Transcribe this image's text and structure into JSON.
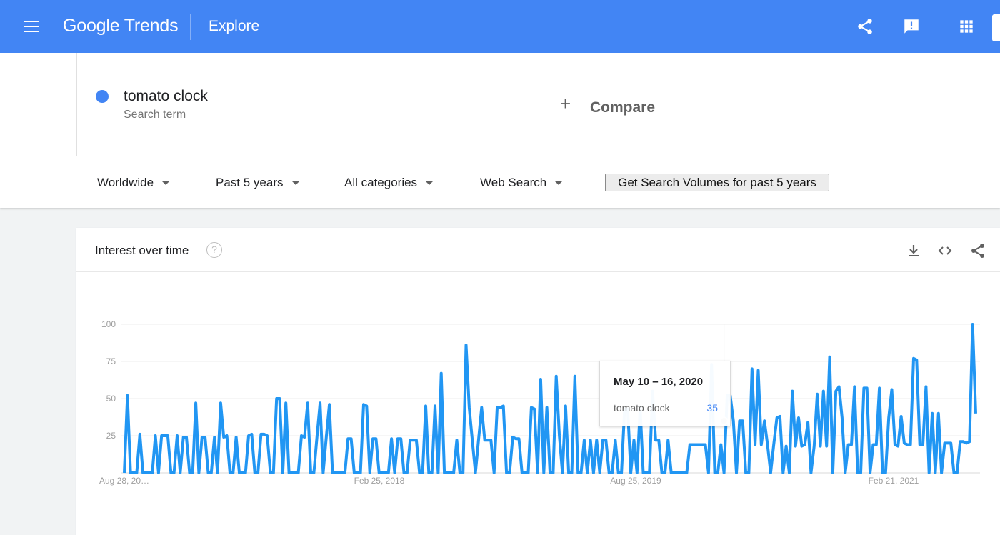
{
  "header": {
    "logo": "Google Trends",
    "section": "Explore",
    "icons": [
      "menu-icon",
      "share-icon",
      "feedback-icon",
      "apps-icon"
    ]
  },
  "search_term": {
    "name": "tomato clock",
    "subtitle": "Search term",
    "color": "#4285f4"
  },
  "compare": {
    "plus": "+",
    "label": "Compare"
  },
  "filters": {
    "region": "Worldwide",
    "period": "Past 5 years",
    "category": "All categories",
    "search_type": "Web Search",
    "volume_button": "Get Search Volumes for past 5 years"
  },
  "card": {
    "title": "Interest over time",
    "help": "?"
  },
  "tooltip": {
    "date": "May 10 – 16, 2020",
    "term": "tomato clock",
    "value": "35"
  },
  "chart_data": {
    "type": "line",
    "x_start": "Aug 28, 2016",
    "x_interval_days": 7,
    "x_tick_labels": [
      "Aug 28, 20…",
      "Feb 25, 2018",
      "Aug 25, 2019",
      "Feb 21, 2021"
    ],
    "y_ticks": [
      25,
      50,
      75,
      100
    ],
    "ylim": [
      0,
      100
    ],
    "grid": true,
    "line_color": "#2196f3",
    "series": [
      {
        "name": "tomato clock",
        "values": [
          0,
          52,
          0,
          0,
          0,
          26,
          0,
          0,
          0,
          0,
          25,
          0,
          25,
          25,
          25,
          0,
          0,
          25,
          0,
          24,
          24,
          0,
          0,
          47,
          0,
          24,
          24,
          0,
          0,
          24,
          0,
          47,
          24,
          25,
          0,
          0,
          24,
          0,
          0,
          0,
          25,
          26,
          0,
          0,
          26,
          26,
          25,
          0,
          0,
          50,
          50,
          0,
          47,
          0,
          0,
          0,
          0,
          25,
          24,
          47,
          0,
          0,
          24,
          47,
          0,
          24,
          46,
          0,
          0,
          0,
          0,
          0,
          23,
          23,
          0,
          0,
          0,
          46,
          45,
          0,
          23,
          23,
          0,
          0,
          0,
          0,
          23,
          0,
          23,
          23,
          0,
          0,
          22,
          22,
          22,
          0,
          0,
          45,
          0,
          0,
          45,
          0,
          67,
          0,
          0,
          0,
          0,
          22,
          0,
          0,
          86,
          44,
          22,
          0,
          22,
          44,
          22,
          22,
          22,
          0,
          44,
          44,
          45,
          0,
          0,
          24,
          23,
          23,
          0,
          0,
          0,
          44,
          43,
          0,
          63,
          0,
          44,
          0,
          0,
          65,
          25,
          0,
          45,
          0,
          0,
          65,
          0,
          0,
          22,
          0,
          22,
          0,
          22,
          0,
          22,
          22,
          0,
          0,
          22,
          0,
          0,
          43,
          43,
          0,
          22,
          0,
          44,
          0,
          0,
          0,
          55,
          22,
          22,
          0,
          0,
          22,
          0,
          0,
          0,
          0,
          0,
          0,
          19,
          19,
          19,
          19,
          19,
          19,
          0,
          73,
          0,
          0,
          19,
          0,
          52,
          52,
          35,
          0,
          35,
          35,
          0,
          0,
          70,
          19,
          69,
          19,
          35,
          19,
          0,
          19,
          37,
          38,
          0,
          18,
          0,
          55,
          18,
          37,
          18,
          19,
          34,
          0,
          18,
          53,
          18,
          55,
          18,
          78,
          0,
          55,
          58,
          37,
          0,
          19,
          19,
          58,
          0,
          0,
          57,
          57,
          0,
          19,
          19,
          57,
          0,
          0,
          37,
          56,
          19,
          18,
          38,
          20,
          19,
          19,
          77,
          76,
          19,
          19,
          58,
          0,
          40,
          0,
          40,
          0,
          20,
          20,
          20,
          0,
          0,
          21,
          21,
          20,
          21,
          100,
          40
        ]
      }
    ],
    "highlight_index": 193,
    "highlight_value": 35
  }
}
